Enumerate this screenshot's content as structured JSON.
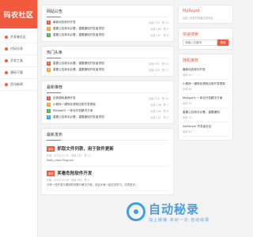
{
  "logo": "码农社区",
  "nav": [
    "开发者社区",
    "代码分享",
    "开发工具",
    "源码下载",
    "资讯新闻"
  ],
  "notice": {
    "title": "网站公告",
    "items": [
      {
        "tag": "1",
        "color": "#f25a3e",
        "text": "最新动态软件开发",
        "views": "阅读 233",
        "likes": "赞 12"
      },
      {
        "tag": "2",
        "color": "#f2a33e",
        "text": "重要公告新手必看，重要通知开发者须知",
        "views": "阅读 189",
        "likes": "赞 9"
      },
      {
        "tag": "3",
        "color": "#4cb24c",
        "text": "重要公告新手必看，重要通知开发者须知",
        "views": "阅读 167",
        "likes": "赞 8"
      }
    ]
  },
  "hot": {
    "title": "热门头条",
    "items": [
      {
        "tag": "1",
        "color": "#f25a3e",
        "text": "重要公告新手必看，重要通知开发者须知",
        "views": "阅读 301",
        "likes": "赞 15"
      },
      {
        "tag": "2",
        "color": "#f2a33e",
        "text": "重要公告新手必看，重要通知开发者须知",
        "views": "阅读 276",
        "likes": "赞 11"
      }
    ]
  },
  "latest": {
    "title": "最新推荐",
    "items": [
      {
        "tag": "1",
        "color": "#f25a3e",
        "text": "优秀源码推荐开发",
        "views": "阅读 220",
        "likes": "赞 10"
      },
      {
        "tag": "2",
        "color": "#f2a33e",
        "text": "小程序一键转化源码应用开发框架",
        "views": "阅读 198",
        "likes": "赞 7"
      },
      {
        "tag": "3",
        "color": "#4cb24c",
        "text": "MyApp01 一体化开发解决方案",
        "views": "阅读 164",
        "likes": "赞 6"
      },
      {
        "tag": "4",
        "color": "#3aa0e8",
        "text": "重要公告新手必看，重要通知开发者须知",
        "views": "阅读 121",
        "likes": "赞 4"
      }
    ]
  },
  "posts": {
    "title": "最新发布",
    "items": [
      {
        "badge": "原创",
        "title": "抓取文件列表，用于软件更新",
        "info": "作者 · 2023-11-02 · 阅读 233 · 赞 12",
        "desc": "Math_class Program"
      },
      {
        "badge": "原创",
        "title": "笑看危险软件开发",
        "info": "作者 · 2023-10-28 · 阅读 188 · 赞 9",
        "desc": "分享一些开发中遇到的问题与解决方案，欢迎大家一起交流学习，共同进步。"
      }
    ]
  },
  "right": {
    "brand": "MyRapid",
    "brand_sub": "社区一站式开发者交流平台",
    "search_title": "快速搜索",
    "search_placeholder": "请输入关键词",
    "search_button": "搜索",
    "random_title": "随机推荐",
    "random": [
      {
        "text": "最新动态软件开发",
        "meta": "阅读 95"
      },
      {
        "text": "小程序一键转化源码应用开发框架",
        "meta": "阅读 88"
      },
      {
        "text": "MyApp01 一体化开发解决方案",
        "meta": "阅读 76"
      },
      {
        "text": "重要公告新手必看，重要通知",
        "meta": "阅读 70"
      },
      {
        "text": "SqlServer 开发者社区",
        "meta": "阅读 62"
      }
    ]
  },
  "watermark": {
    "big": "自动秘录",
    "small": "加上链接·末动一次·自动收录"
  }
}
